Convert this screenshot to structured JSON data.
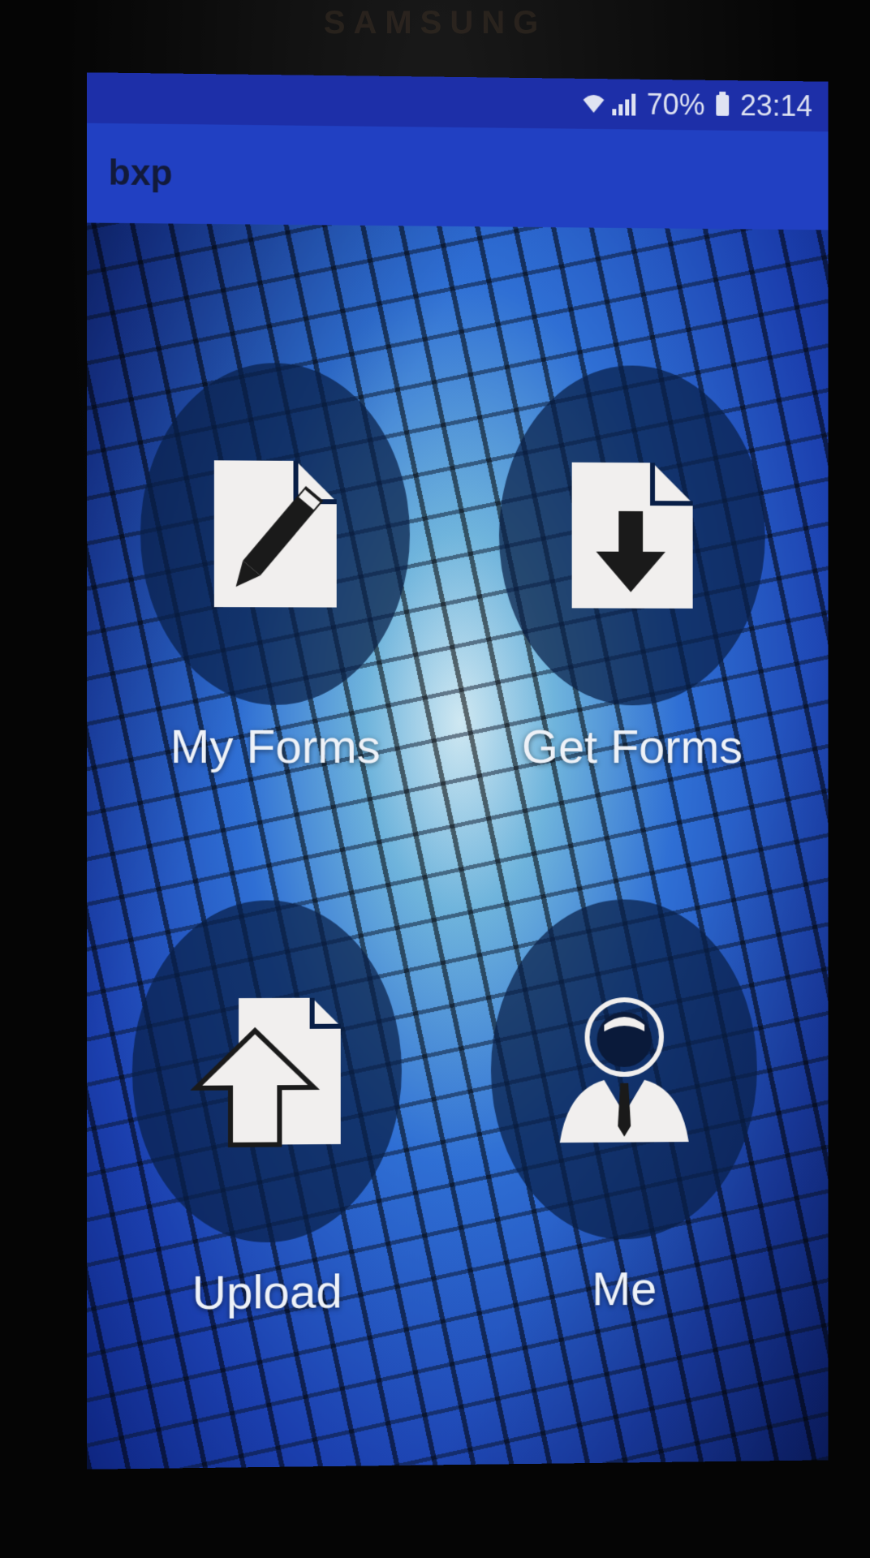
{
  "device": {
    "brand_text": "SAMSUNG"
  },
  "status_bar": {
    "battery_percent": "70%",
    "time": "23:14"
  },
  "app_bar": {
    "title": "bxp"
  },
  "tiles": [
    {
      "label": "My Forms",
      "icon": "edit-document-icon"
    },
    {
      "label": "Get Forms",
      "icon": "download-document-icon"
    },
    {
      "label": "Upload",
      "icon": "upload-document-icon"
    },
    {
      "label": "Me",
      "icon": "user-profile-icon"
    }
  ],
  "colors": {
    "status_bar": "#1d2fa8",
    "app_bar": "#2140c2",
    "tile_circle": "#081e46",
    "icon": "#f1efee"
  }
}
